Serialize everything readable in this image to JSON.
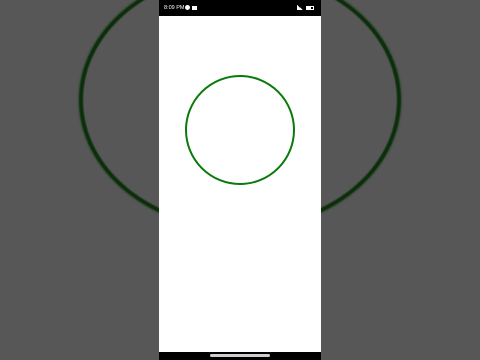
{
  "status_bar": {
    "time": "8:09 PM",
    "left_icons": [
      "circle-notification-icon",
      "camera-icon"
    ],
    "right_icons": [
      "signal-icon",
      "battery-icon"
    ]
  },
  "colors": {
    "background": "#575757",
    "screen": "#ffffff",
    "circle_stroke": "#0a7a0a",
    "status_bar": "#000000"
  }
}
